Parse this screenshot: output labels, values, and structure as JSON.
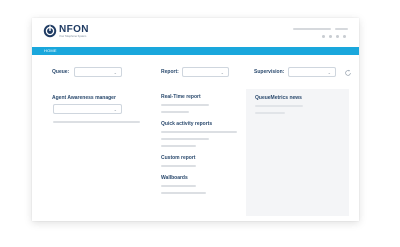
{
  "header": {
    "logo_text": "NFON",
    "logo_tagline": "Your Telephone System"
  },
  "nav": {
    "home_label": "HOME"
  },
  "filters": {
    "queue_label": "Queue:",
    "report_label": "Report:",
    "supervision_label": "Supervision:"
  },
  "sections": {
    "agent_awareness_title": "Agent Awareness manager",
    "realtime_report_title": "Real-Time report",
    "quick_activity_title": "Quick activity reports",
    "custom_report_title": "Custom report",
    "wallboards_title": "Wallboards",
    "queuemetrics_news_title": "QueueMetrics news"
  },
  "colors": {
    "accent": "#1aa7dc",
    "brand_dark": "#1f3b63",
    "heading": "#2b4a6e",
    "placeholder_line": "#dcdfe3",
    "panel_bg": "#f4f5f7"
  },
  "icons": {
    "logo": "nfon-logo-icon",
    "chevron": "chevron-down-icon",
    "refresh": "refresh-icon"
  }
}
